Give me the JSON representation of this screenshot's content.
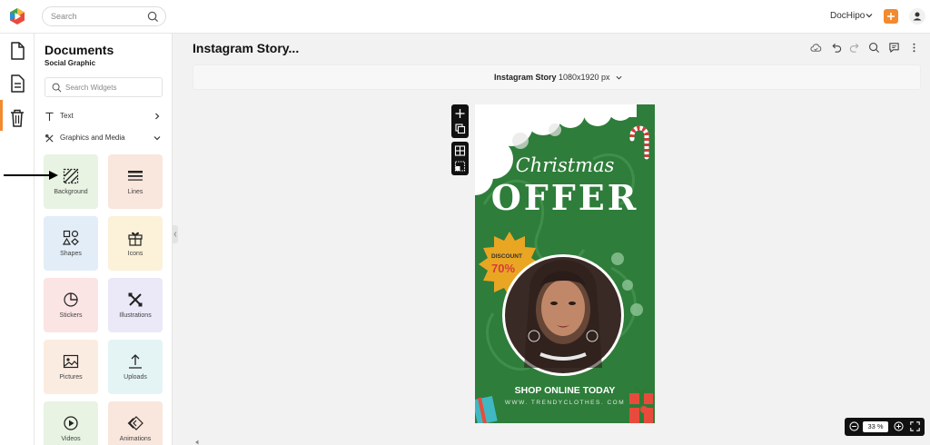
{
  "header": {
    "search_placeholder": "Search",
    "brand_name": "DocHipo",
    "brand_color": "#f28a2e"
  },
  "rail": {
    "items": [
      "document-icon",
      "document-text-icon",
      "trash-icon"
    ],
    "active_index": 1
  },
  "panel": {
    "title": "Documents",
    "subtitle": "Social Graphic",
    "widget_search_placeholder": "Search Widgets",
    "sections": [
      {
        "label": "Text",
        "expanded": false
      },
      {
        "label": "Graphics and Media",
        "expanded": true
      }
    ],
    "tiles": [
      {
        "label": "Background",
        "icon": "background-icon",
        "color": "#e8f3e3"
      },
      {
        "label": "Lines",
        "icon": "lines-icon",
        "color": "#f9e6dc"
      },
      {
        "label": "Shapes",
        "icon": "shapes-icon",
        "color": "#e3edf7"
      },
      {
        "label": "Icons",
        "icon": "gift-icon",
        "color": "#fcf1d9"
      },
      {
        "label": "Stickers",
        "icon": "sticker-icon",
        "color": "#fbe4e4"
      },
      {
        "label": "Illustrations",
        "icon": "illustrations-icon",
        "color": "#ebe8f8"
      },
      {
        "label": "Pictures",
        "icon": "picture-icon",
        "color": "#fbece1"
      },
      {
        "label": "Uploads",
        "icon": "upload-icon",
        "color": "#e4f4f4"
      },
      {
        "label": "Videos",
        "icon": "video-icon",
        "color": "#e8f3e3"
      },
      {
        "label": "Animations",
        "icon": "animation-icon",
        "color": "#f9e6dc"
      }
    ]
  },
  "workspace": {
    "doc_title": "Instagram Story...",
    "format_name": "Instagram Story",
    "format_size": "1080x1920 px",
    "zoom": "33",
    "zoom_unit": "%"
  },
  "design": {
    "script_word": "Christmas",
    "headline": "OFFER",
    "discount_label": "DISCOUNT",
    "discount_value": "70%",
    "cta": "SHOP ONLINE TODAY",
    "website": "WWW. TRENDYCLOTHES. COM",
    "bg_color": "#2e7d3a",
    "badge_color": "#e9a623"
  }
}
